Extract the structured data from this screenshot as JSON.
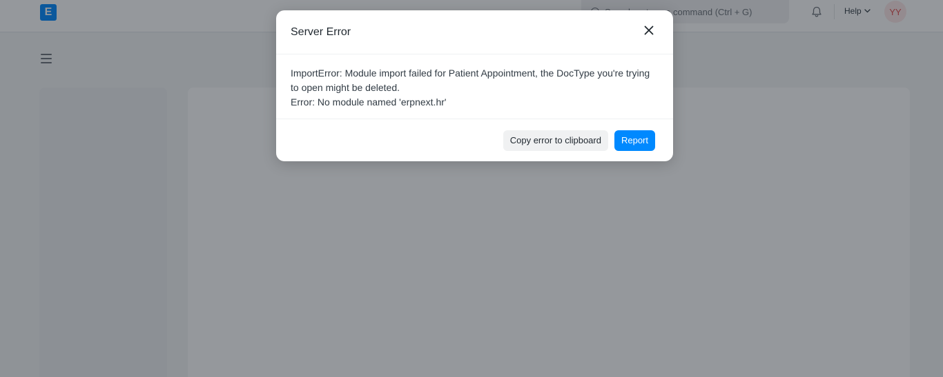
{
  "navbar": {
    "logo_letter": "E",
    "search_placeholder": "Search or type a command (Ctrl + G)",
    "help_label": "Help",
    "avatar_initials": "YY"
  },
  "modal": {
    "title": "Server Error",
    "message_line1": "ImportError: Module import failed for Patient Appointment, the DocType you're trying to open might be deleted.",
    "message_line2": "Error: No module named 'erpnext.hr'",
    "copy_button_label": "Copy error to clipboard",
    "report_button_label": "Report"
  },
  "colors": {
    "primary": "#0089ff",
    "avatar_bg": "#fde7e7",
    "avatar_text": "#e24c4c"
  }
}
